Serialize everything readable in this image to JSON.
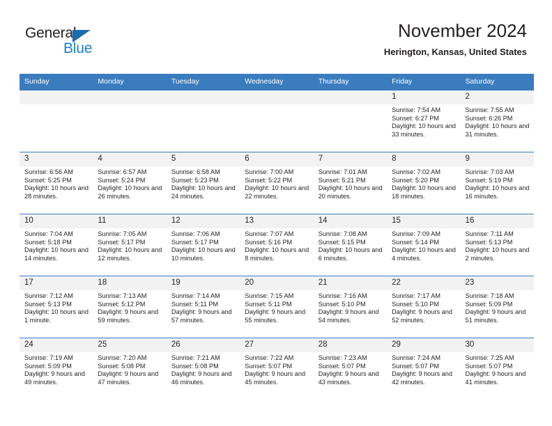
{
  "logo": {
    "word_top": "General",
    "word_bottom": "Blue",
    "triangle_color": "#1b6cb0",
    "blue_color": "#1f7fc4"
  },
  "header": {
    "title": "November 2024",
    "subtitle": "Herington, Kansas, United States"
  },
  "theme": {
    "header_blue": "#3a7cbe",
    "daynum_band": "#f2f2f2",
    "text": "#231f20"
  },
  "calendar": {
    "weekday_headers": [
      "Sunday",
      "Monday",
      "Tuesday",
      "Wednesday",
      "Thursday",
      "Friday",
      "Saturday"
    ],
    "weeks": [
      [
        {
          "day": "",
          "sunrise": "",
          "sunset": "",
          "daylight": ""
        },
        {
          "day": "",
          "sunrise": "",
          "sunset": "",
          "daylight": ""
        },
        {
          "day": "",
          "sunrise": "",
          "sunset": "",
          "daylight": ""
        },
        {
          "day": "",
          "sunrise": "",
          "sunset": "",
          "daylight": ""
        },
        {
          "day": "",
          "sunrise": "",
          "sunset": "",
          "daylight": ""
        },
        {
          "day": "1",
          "sunrise": "Sunrise: 7:54 AM",
          "sunset": "Sunset: 6:27 PM",
          "daylight": "Daylight: 10 hours and 33 minutes."
        },
        {
          "day": "2",
          "sunrise": "Sunrise: 7:55 AM",
          "sunset": "Sunset: 6:26 PM",
          "daylight": "Daylight: 10 hours and 31 minutes."
        }
      ],
      [
        {
          "day": "3",
          "sunrise": "Sunrise: 6:56 AM",
          "sunset": "Sunset: 5:25 PM",
          "daylight": "Daylight: 10 hours and 28 minutes."
        },
        {
          "day": "4",
          "sunrise": "Sunrise: 6:57 AM",
          "sunset": "Sunset: 5:24 PM",
          "daylight": "Daylight: 10 hours and 26 minutes."
        },
        {
          "day": "5",
          "sunrise": "Sunrise: 6:58 AM",
          "sunset": "Sunset: 5:23 PM",
          "daylight": "Daylight: 10 hours and 24 minutes."
        },
        {
          "day": "6",
          "sunrise": "Sunrise: 7:00 AM",
          "sunset": "Sunset: 5:22 PM",
          "daylight": "Daylight: 10 hours and 22 minutes."
        },
        {
          "day": "7",
          "sunrise": "Sunrise: 7:01 AM",
          "sunset": "Sunset: 5:21 PM",
          "daylight": "Daylight: 10 hours and 20 minutes."
        },
        {
          "day": "8",
          "sunrise": "Sunrise: 7:02 AM",
          "sunset": "Sunset: 5:20 PM",
          "daylight": "Daylight: 10 hours and 18 minutes."
        },
        {
          "day": "9",
          "sunrise": "Sunrise: 7:03 AM",
          "sunset": "Sunset: 5:19 PM",
          "daylight": "Daylight: 10 hours and 16 minutes."
        }
      ],
      [
        {
          "day": "10",
          "sunrise": "Sunrise: 7:04 AM",
          "sunset": "Sunset: 5:18 PM",
          "daylight": "Daylight: 10 hours and 14 minutes."
        },
        {
          "day": "11",
          "sunrise": "Sunrise: 7:05 AM",
          "sunset": "Sunset: 5:17 PM",
          "daylight": "Daylight: 10 hours and 12 minutes."
        },
        {
          "day": "12",
          "sunrise": "Sunrise: 7:06 AM",
          "sunset": "Sunset: 5:17 PM",
          "daylight": "Daylight: 10 hours and 10 minutes."
        },
        {
          "day": "13",
          "sunrise": "Sunrise: 7:07 AM",
          "sunset": "Sunset: 5:16 PM",
          "daylight": "Daylight: 10 hours and 8 minutes."
        },
        {
          "day": "14",
          "sunrise": "Sunrise: 7:08 AM",
          "sunset": "Sunset: 5:15 PM",
          "daylight": "Daylight: 10 hours and 6 minutes."
        },
        {
          "day": "15",
          "sunrise": "Sunrise: 7:09 AM",
          "sunset": "Sunset: 5:14 PM",
          "daylight": "Daylight: 10 hours and 4 minutes."
        },
        {
          "day": "16",
          "sunrise": "Sunrise: 7:11 AM",
          "sunset": "Sunset: 5:13 PM",
          "daylight": "Daylight: 10 hours and 2 minutes."
        }
      ],
      [
        {
          "day": "17",
          "sunrise": "Sunrise: 7:12 AM",
          "sunset": "Sunset: 5:13 PM",
          "daylight": "Daylight: 10 hours and 1 minute."
        },
        {
          "day": "18",
          "sunrise": "Sunrise: 7:13 AM",
          "sunset": "Sunset: 5:12 PM",
          "daylight": "Daylight: 9 hours and 59 minutes."
        },
        {
          "day": "19",
          "sunrise": "Sunrise: 7:14 AM",
          "sunset": "Sunset: 5:11 PM",
          "daylight": "Daylight: 9 hours and 57 minutes."
        },
        {
          "day": "20",
          "sunrise": "Sunrise: 7:15 AM",
          "sunset": "Sunset: 5:11 PM",
          "daylight": "Daylight: 9 hours and 55 minutes."
        },
        {
          "day": "21",
          "sunrise": "Sunrise: 7:16 AM",
          "sunset": "Sunset: 5:10 PM",
          "daylight": "Daylight: 9 hours and 54 minutes."
        },
        {
          "day": "22",
          "sunrise": "Sunrise: 7:17 AM",
          "sunset": "Sunset: 5:10 PM",
          "daylight": "Daylight: 9 hours and 52 minutes."
        },
        {
          "day": "23",
          "sunrise": "Sunrise: 7:18 AM",
          "sunset": "Sunset: 5:09 PM",
          "daylight": "Daylight: 9 hours and 51 minutes."
        }
      ],
      [
        {
          "day": "24",
          "sunrise": "Sunrise: 7:19 AM",
          "sunset": "Sunset: 5:09 PM",
          "daylight": "Daylight: 9 hours and 49 minutes."
        },
        {
          "day": "25",
          "sunrise": "Sunrise: 7:20 AM",
          "sunset": "Sunset: 5:08 PM",
          "daylight": "Daylight: 9 hours and 47 minutes."
        },
        {
          "day": "26",
          "sunrise": "Sunrise: 7:21 AM",
          "sunset": "Sunset: 5:08 PM",
          "daylight": "Daylight: 9 hours and 46 minutes."
        },
        {
          "day": "27",
          "sunrise": "Sunrise: 7:22 AM",
          "sunset": "Sunset: 5:07 PM",
          "daylight": "Daylight: 9 hours and 45 minutes."
        },
        {
          "day": "28",
          "sunrise": "Sunrise: 7:23 AM",
          "sunset": "Sunset: 5:07 PM",
          "daylight": "Daylight: 9 hours and 43 minutes."
        },
        {
          "day": "29",
          "sunrise": "Sunrise: 7:24 AM",
          "sunset": "Sunset: 5:07 PM",
          "daylight": "Daylight: 9 hours and 42 minutes."
        },
        {
          "day": "30",
          "sunrise": "Sunrise: 7:25 AM",
          "sunset": "Sunset: 5:07 PM",
          "daylight": "Daylight: 9 hours and 41 minutes."
        }
      ]
    ]
  }
}
